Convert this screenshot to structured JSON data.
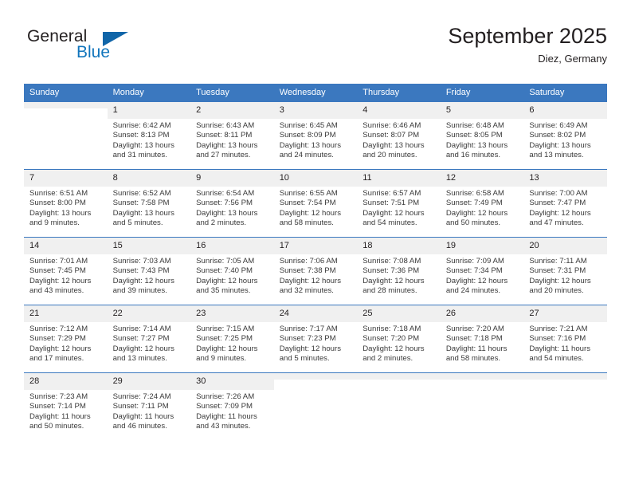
{
  "logo": {
    "primary_text": "General",
    "secondary_text": "Blue",
    "triangle_color": "#1065a8",
    "blue_color": "#1175bc"
  },
  "header": {
    "month_title": "September 2025",
    "location": "Diez, Germany"
  },
  "theme": {
    "header_bg": "#3b78bf",
    "daynum_bg": "#f0f0f0",
    "row_border": "#3b78bf",
    "text": "#231f20"
  },
  "weekday_headers": [
    "Sunday",
    "Monday",
    "Tuesday",
    "Wednesday",
    "Thursday",
    "Friday",
    "Saturday"
  ],
  "weeks": [
    [
      {
        "day": "",
        "empty": true,
        "sunrise": "",
        "sunset": "",
        "daylight_line1": "",
        "daylight_line2": ""
      },
      {
        "day": "1",
        "sunrise": "Sunrise: 6:42 AM",
        "sunset": "Sunset: 8:13 PM",
        "daylight_line1": "Daylight: 13 hours",
        "daylight_line2": "and 31 minutes."
      },
      {
        "day": "2",
        "sunrise": "Sunrise: 6:43 AM",
        "sunset": "Sunset: 8:11 PM",
        "daylight_line1": "Daylight: 13 hours",
        "daylight_line2": "and 27 minutes."
      },
      {
        "day": "3",
        "sunrise": "Sunrise: 6:45 AM",
        "sunset": "Sunset: 8:09 PM",
        "daylight_line1": "Daylight: 13 hours",
        "daylight_line2": "and 24 minutes."
      },
      {
        "day": "4",
        "sunrise": "Sunrise: 6:46 AM",
        "sunset": "Sunset: 8:07 PM",
        "daylight_line1": "Daylight: 13 hours",
        "daylight_line2": "and 20 minutes."
      },
      {
        "day": "5",
        "sunrise": "Sunrise: 6:48 AM",
        "sunset": "Sunset: 8:05 PM",
        "daylight_line1": "Daylight: 13 hours",
        "daylight_line2": "and 16 minutes."
      },
      {
        "day": "6",
        "sunrise": "Sunrise: 6:49 AM",
        "sunset": "Sunset: 8:02 PM",
        "daylight_line1": "Daylight: 13 hours",
        "daylight_line2": "and 13 minutes."
      }
    ],
    [
      {
        "day": "7",
        "sunrise": "Sunrise: 6:51 AM",
        "sunset": "Sunset: 8:00 PM",
        "daylight_line1": "Daylight: 13 hours",
        "daylight_line2": "and 9 minutes."
      },
      {
        "day": "8",
        "sunrise": "Sunrise: 6:52 AM",
        "sunset": "Sunset: 7:58 PM",
        "daylight_line1": "Daylight: 13 hours",
        "daylight_line2": "and 5 minutes."
      },
      {
        "day": "9",
        "sunrise": "Sunrise: 6:54 AM",
        "sunset": "Sunset: 7:56 PM",
        "daylight_line1": "Daylight: 13 hours",
        "daylight_line2": "and 2 minutes."
      },
      {
        "day": "10",
        "sunrise": "Sunrise: 6:55 AM",
        "sunset": "Sunset: 7:54 PM",
        "daylight_line1": "Daylight: 12 hours",
        "daylight_line2": "and 58 minutes."
      },
      {
        "day": "11",
        "sunrise": "Sunrise: 6:57 AM",
        "sunset": "Sunset: 7:51 PM",
        "daylight_line1": "Daylight: 12 hours",
        "daylight_line2": "and 54 minutes."
      },
      {
        "day": "12",
        "sunrise": "Sunrise: 6:58 AM",
        "sunset": "Sunset: 7:49 PM",
        "daylight_line1": "Daylight: 12 hours",
        "daylight_line2": "and 50 minutes."
      },
      {
        "day": "13",
        "sunrise": "Sunrise: 7:00 AM",
        "sunset": "Sunset: 7:47 PM",
        "daylight_line1": "Daylight: 12 hours",
        "daylight_line2": "and 47 minutes."
      }
    ],
    [
      {
        "day": "14",
        "sunrise": "Sunrise: 7:01 AM",
        "sunset": "Sunset: 7:45 PM",
        "daylight_line1": "Daylight: 12 hours",
        "daylight_line2": "and 43 minutes."
      },
      {
        "day": "15",
        "sunrise": "Sunrise: 7:03 AM",
        "sunset": "Sunset: 7:43 PM",
        "daylight_line1": "Daylight: 12 hours",
        "daylight_line2": "and 39 minutes."
      },
      {
        "day": "16",
        "sunrise": "Sunrise: 7:05 AM",
        "sunset": "Sunset: 7:40 PM",
        "daylight_line1": "Daylight: 12 hours",
        "daylight_line2": "and 35 minutes."
      },
      {
        "day": "17",
        "sunrise": "Sunrise: 7:06 AM",
        "sunset": "Sunset: 7:38 PM",
        "daylight_line1": "Daylight: 12 hours",
        "daylight_line2": "and 32 minutes."
      },
      {
        "day": "18",
        "sunrise": "Sunrise: 7:08 AM",
        "sunset": "Sunset: 7:36 PM",
        "daylight_line1": "Daylight: 12 hours",
        "daylight_line2": "and 28 minutes."
      },
      {
        "day": "19",
        "sunrise": "Sunrise: 7:09 AM",
        "sunset": "Sunset: 7:34 PM",
        "daylight_line1": "Daylight: 12 hours",
        "daylight_line2": "and 24 minutes."
      },
      {
        "day": "20",
        "sunrise": "Sunrise: 7:11 AM",
        "sunset": "Sunset: 7:31 PM",
        "daylight_line1": "Daylight: 12 hours",
        "daylight_line2": "and 20 minutes."
      }
    ],
    [
      {
        "day": "21",
        "sunrise": "Sunrise: 7:12 AM",
        "sunset": "Sunset: 7:29 PM",
        "daylight_line1": "Daylight: 12 hours",
        "daylight_line2": "and 17 minutes."
      },
      {
        "day": "22",
        "sunrise": "Sunrise: 7:14 AM",
        "sunset": "Sunset: 7:27 PM",
        "daylight_line1": "Daylight: 12 hours",
        "daylight_line2": "and 13 minutes."
      },
      {
        "day": "23",
        "sunrise": "Sunrise: 7:15 AM",
        "sunset": "Sunset: 7:25 PM",
        "daylight_line1": "Daylight: 12 hours",
        "daylight_line2": "and 9 minutes."
      },
      {
        "day": "24",
        "sunrise": "Sunrise: 7:17 AM",
        "sunset": "Sunset: 7:23 PM",
        "daylight_line1": "Daylight: 12 hours",
        "daylight_line2": "and 5 minutes."
      },
      {
        "day": "25",
        "sunrise": "Sunrise: 7:18 AM",
        "sunset": "Sunset: 7:20 PM",
        "daylight_line1": "Daylight: 12 hours",
        "daylight_line2": "and 2 minutes."
      },
      {
        "day": "26",
        "sunrise": "Sunrise: 7:20 AM",
        "sunset": "Sunset: 7:18 PM",
        "daylight_line1": "Daylight: 11 hours",
        "daylight_line2": "and 58 minutes."
      },
      {
        "day": "27",
        "sunrise": "Sunrise: 7:21 AM",
        "sunset": "Sunset: 7:16 PM",
        "daylight_line1": "Daylight: 11 hours",
        "daylight_line2": "and 54 minutes."
      }
    ],
    [
      {
        "day": "28",
        "sunrise": "Sunrise: 7:23 AM",
        "sunset": "Sunset: 7:14 PM",
        "daylight_line1": "Daylight: 11 hours",
        "daylight_line2": "and 50 minutes."
      },
      {
        "day": "29",
        "sunrise": "Sunrise: 7:24 AM",
        "sunset": "Sunset: 7:11 PM",
        "daylight_line1": "Daylight: 11 hours",
        "daylight_line2": "and 46 minutes."
      },
      {
        "day": "30",
        "sunrise": "Sunrise: 7:26 AM",
        "sunset": "Sunset: 7:09 PM",
        "daylight_line1": "Daylight: 11 hours",
        "daylight_line2": "and 43 minutes."
      },
      {
        "day": "",
        "empty": true,
        "sunrise": "",
        "sunset": "",
        "daylight_line1": "",
        "daylight_line2": ""
      },
      {
        "day": "",
        "empty": true,
        "sunrise": "",
        "sunset": "",
        "daylight_line1": "",
        "daylight_line2": ""
      },
      {
        "day": "",
        "empty": true,
        "sunrise": "",
        "sunset": "",
        "daylight_line1": "",
        "daylight_line2": ""
      },
      {
        "day": "",
        "empty": true,
        "sunrise": "",
        "sunset": "",
        "daylight_line1": "",
        "daylight_line2": ""
      }
    ]
  ]
}
